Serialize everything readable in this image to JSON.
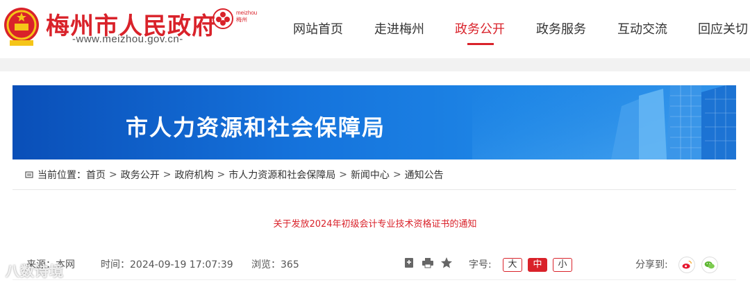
{
  "header": {
    "site_title": "梅州市人民政府",
    "site_url": "-www.meizhou.gov.cn-",
    "city_logo_text_top": "meizhou",
    "city_logo_text_bottom": "梅州"
  },
  "nav": {
    "items": [
      {
        "label": "网站首页"
      },
      {
        "label": "走进梅州"
      },
      {
        "label": "政务公开",
        "active": true
      },
      {
        "label": "政务服务"
      },
      {
        "label": "互动交流"
      },
      {
        "label": "回应关切"
      }
    ]
  },
  "banner": {
    "title": "市人力资源和社会保障局"
  },
  "breadcrumb": {
    "prefix": "当前位置：",
    "items": [
      "首页",
      "政务公开",
      "政府机构",
      "市人力资源和社会保障局",
      "新闻中心",
      "通知公告"
    ],
    "separator": ">"
  },
  "article": {
    "title": "关于发放2024年初级会计专业技术资格证书的通知",
    "source_label": "来源：本网",
    "time_label": "时间：2024-09-19 17:07:39",
    "views_label": "浏览：365",
    "font_size_label": "字号:",
    "font_sizes": [
      "大",
      "中",
      "小"
    ],
    "active_font_size": "中",
    "share_label": "分享到:"
  },
  "watermark": {
    "text": "八数诗境"
  },
  "colors": {
    "accent": "#d9222a",
    "banner_blue": "#1573dc",
    "wechat_green": "#5cb531",
    "weibo_orange": "#e6162d"
  },
  "icons": [
    "national-emblem-icon",
    "city-logo-icon",
    "breadcrumb-location-icon",
    "bookmark-icon",
    "print-icon",
    "star-icon",
    "weibo-icon",
    "wechat-icon"
  ]
}
